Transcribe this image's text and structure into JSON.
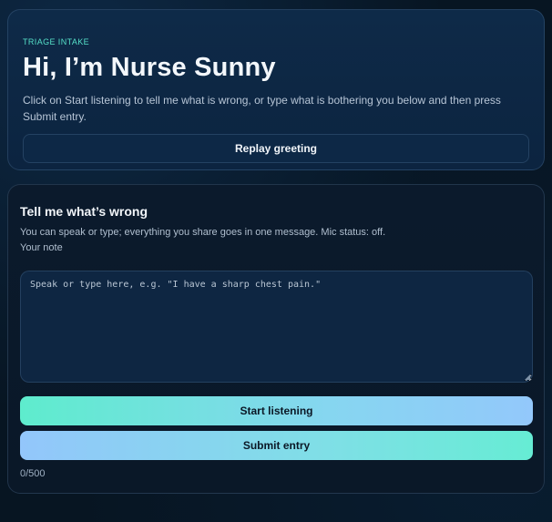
{
  "greeting": {
    "eyebrow": "TRIAGE INTAKE",
    "title": "Hi, I’m Nurse Sunny",
    "intro": "Click on Start listening to tell me what is wrong, or type what is bothering you below and then press Submit entry.",
    "replay_label": "Replay greeting"
  },
  "note": {
    "title": "Tell me what’s wrong",
    "help": "You can speak or type; everything you share goes in one message. Mic status: off.",
    "field_label": "Your note",
    "value": "",
    "placeholder": "Speak or type here, e.g. \"I have a sharp chest pain.\"",
    "start_label": "Start listening",
    "submit_label": "Submit entry",
    "counter": "0/500"
  },
  "colors": {
    "background": "#071522",
    "accent": "#56e0c8",
    "button_gradient_start": "#5eeccd",
    "button_gradient_end": "#93c8fb"
  }
}
